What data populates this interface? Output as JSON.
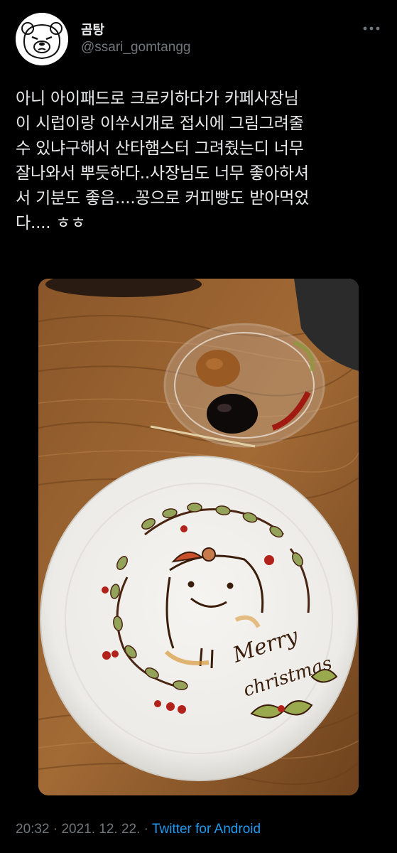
{
  "tweet": {
    "author": {
      "display_name": "곰탕",
      "handle": "@ssari_gomtangg"
    },
    "more_icon": "more-horizontal-icon",
    "text_lines": [
      "아니 아이패드로 크로키하다가 카페사장님",
      "이 시럽이랑 이쑤시개로 접시에 그림그려줄",
      "수 있냐구해서 산타햄스터 그려줬는디 너무",
      "잘나와서 뿌듯하다..사장님도 너무 좋아하셔",
      "서 기분도 좋음....꽁으로 커피빵도 받아먹었",
      "다.... ㅎㅎ"
    ],
    "photo": {
      "plate_text_line1": "Merry",
      "plate_text_line2": "christmas"
    },
    "time": "20:32",
    "separator": "·",
    "date": "2021. 12. 22.",
    "source": "Twitter for Android"
  },
  "colors": {
    "background": "#000000",
    "text_primary": "#e7e9ea",
    "text_secondary": "#71767b",
    "link": "#1d9bf0"
  }
}
